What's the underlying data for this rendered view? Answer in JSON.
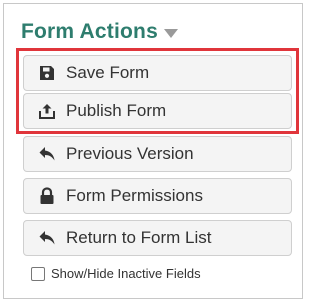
{
  "panel": {
    "title": "Form Actions",
    "accent_color": "#2e7d6e",
    "highlight_color": "#e0353b"
  },
  "buttons": [
    {
      "label": "Save Form",
      "icon": "save-icon"
    },
    {
      "label": "Publish Form",
      "icon": "upload-icon"
    },
    {
      "label": "Previous Version",
      "icon": "back-arrow-icon"
    },
    {
      "label": "Form Permissions",
      "icon": "lock-icon"
    },
    {
      "label": "Return to Form List",
      "icon": "back-arrow-icon"
    }
  ],
  "checkbox": {
    "label": "Show/Hide Inactive Fields",
    "checked": false
  }
}
